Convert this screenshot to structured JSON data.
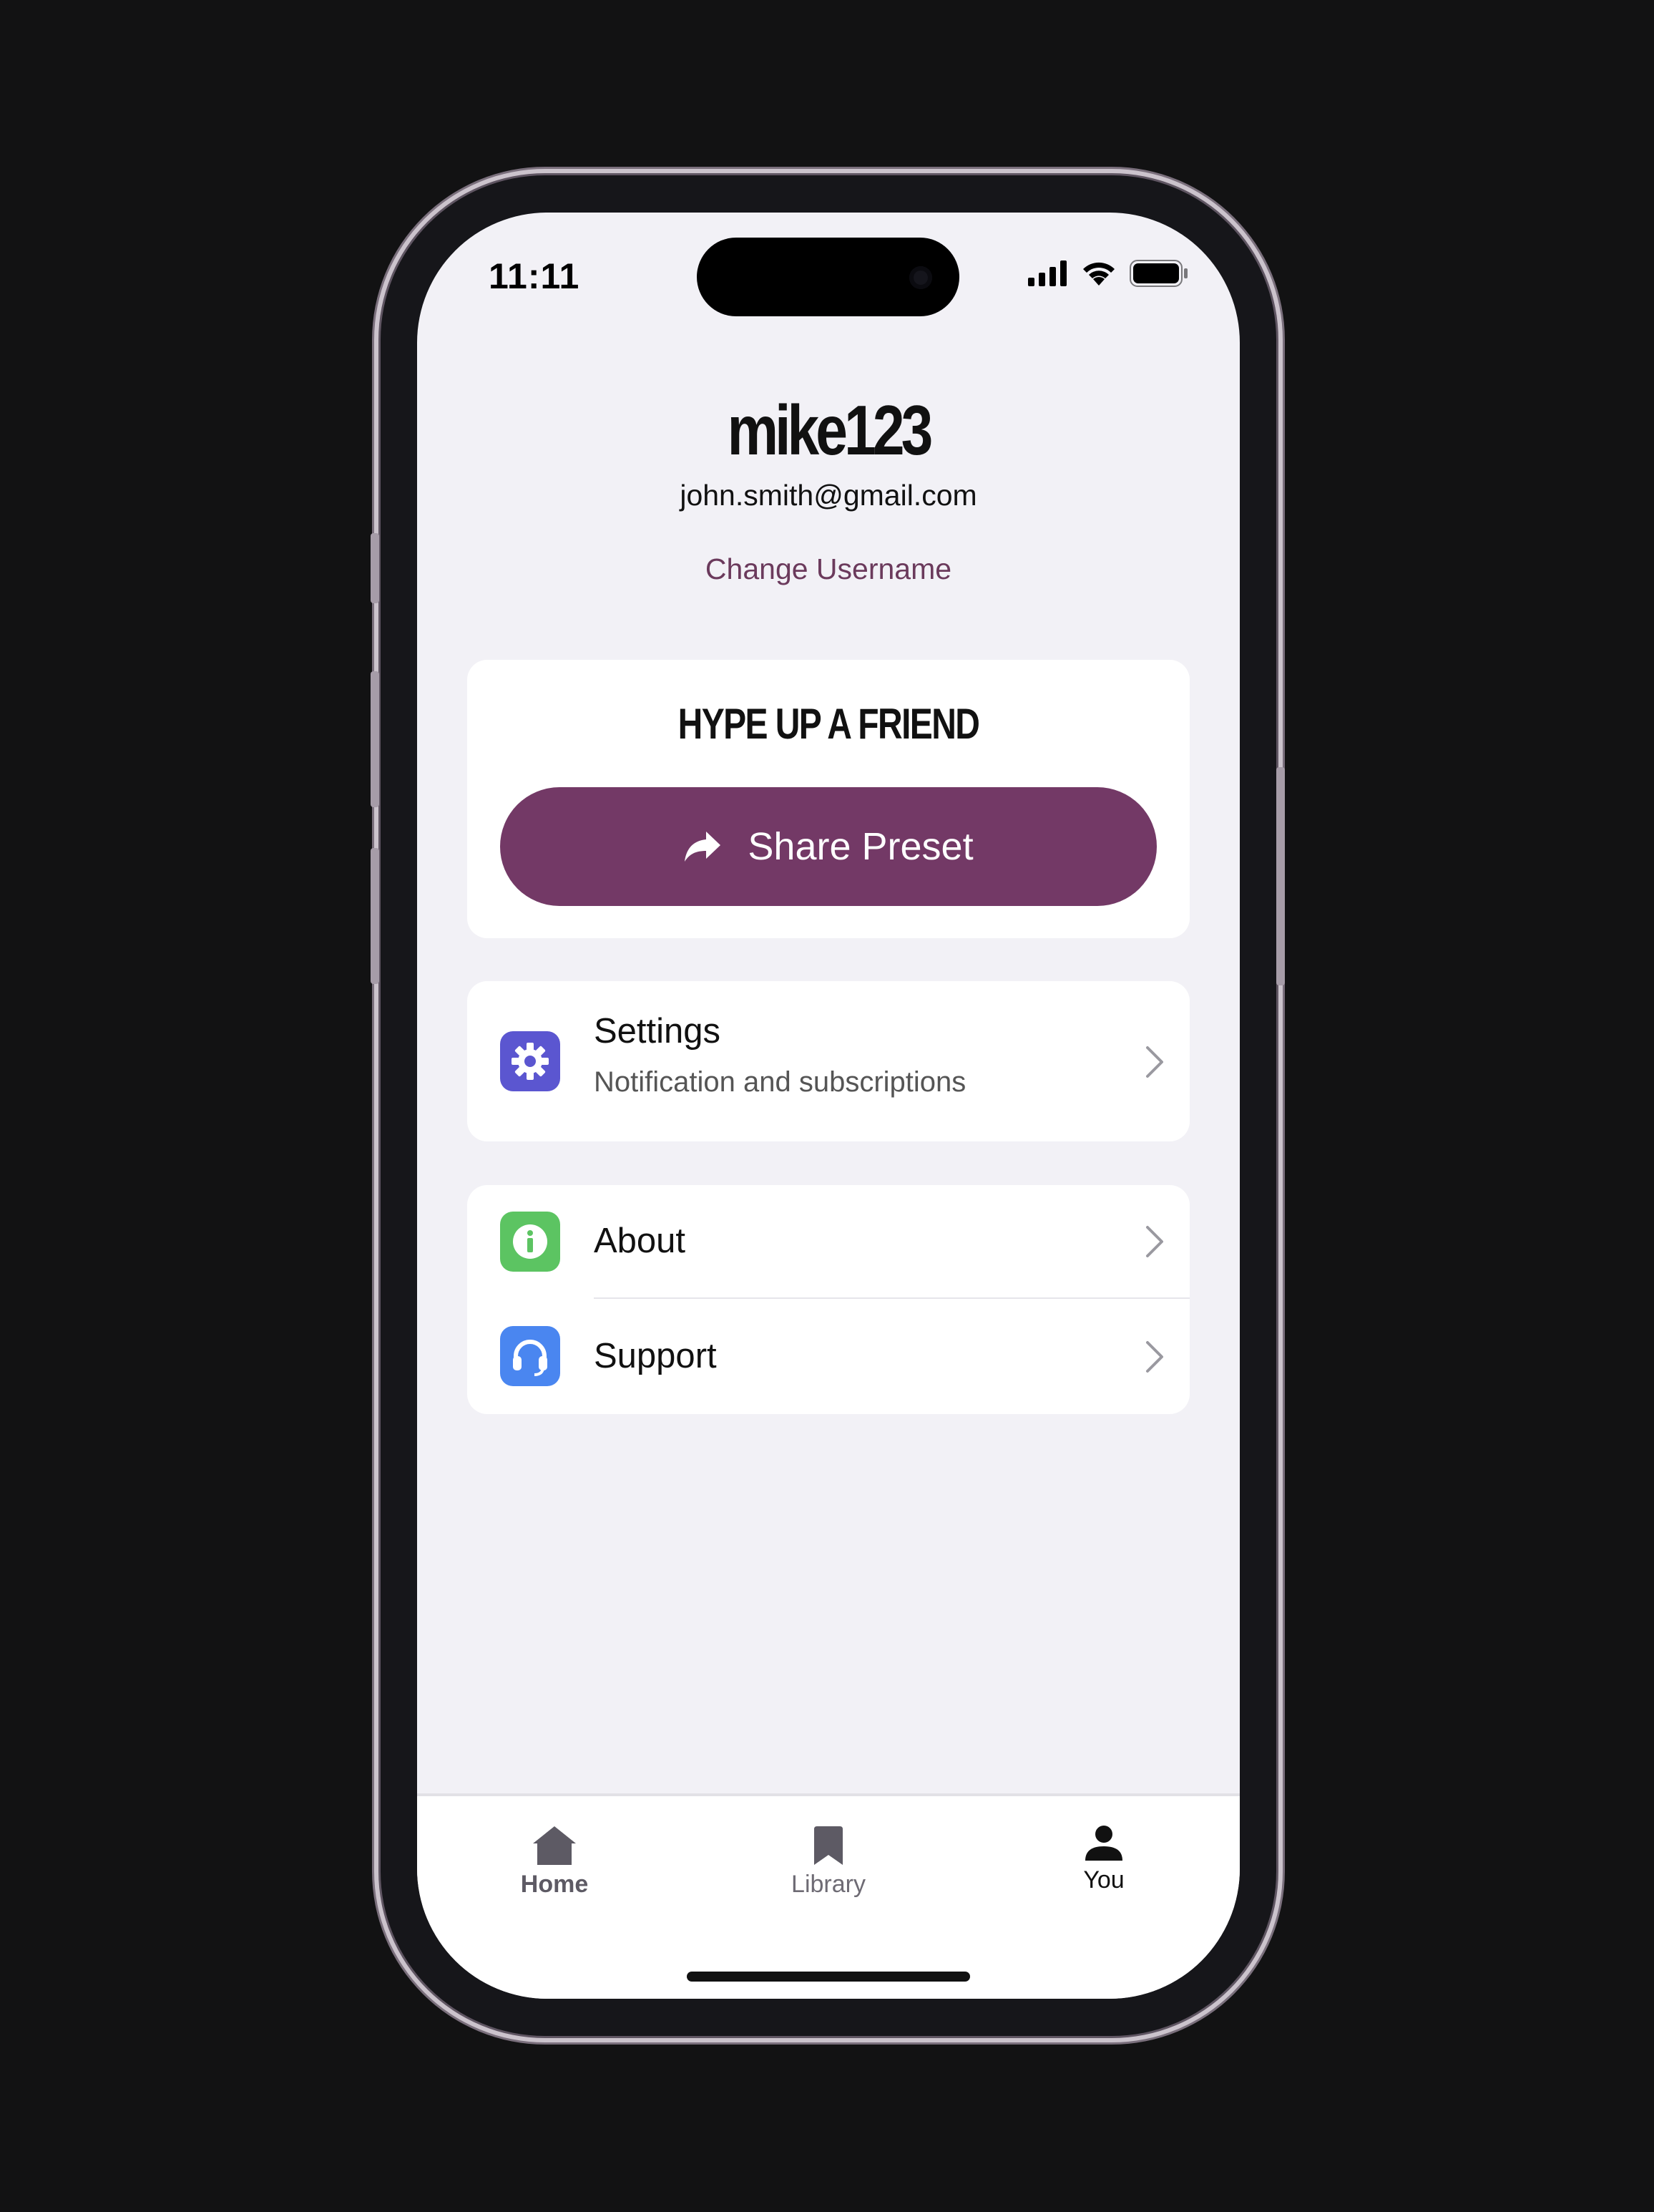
{
  "status_bar": {
    "time": "11:11"
  },
  "profile": {
    "username": "mike123",
    "email": "john.smith@gmail.com",
    "change_username_label": "Change Username"
  },
  "hype_card": {
    "title": "HYPE UP A FRIEND",
    "button_label": "Share Preset",
    "button_icon": "share-arrow-icon"
  },
  "menu": {
    "settings": {
      "title": "Settings",
      "subtitle": "Notification and subscriptions",
      "icon": "gear-icon",
      "icon_color": "#5b56d0"
    },
    "about": {
      "title": "About",
      "icon": "info-icon",
      "icon_color": "#5cc462"
    },
    "support": {
      "title": "Support",
      "icon": "headphones-icon",
      "icon_color": "#4a86f0"
    }
  },
  "tabs": [
    {
      "label": "Home",
      "icon": "home-icon"
    },
    {
      "label": "Library",
      "icon": "bookmark-icon"
    },
    {
      "label": "You",
      "icon": "person-icon"
    }
  ],
  "colors": {
    "accent": "#733966",
    "link": "#6b3a5c",
    "background": "#f2f1f6"
  }
}
